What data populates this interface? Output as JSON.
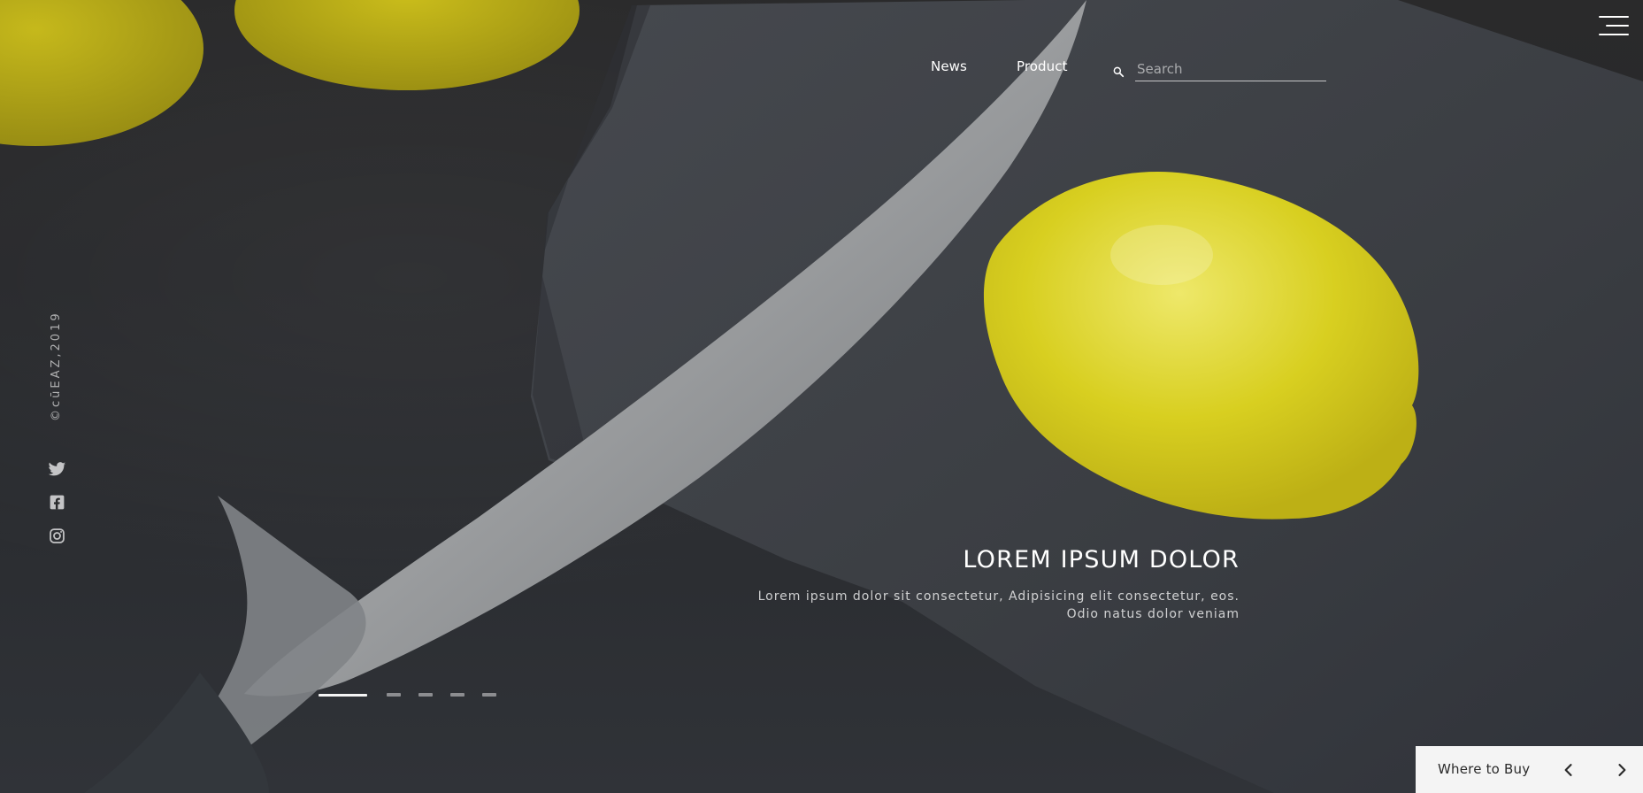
{
  "header": {
    "nav_items": [
      {
        "label": "News"
      },
      {
        "label": "Product"
      }
    ],
    "search": {
      "placeholder": "Search"
    },
    "menu_icon": "hamburger-menu-icon"
  },
  "sidebar": {
    "copyright": "©cūEAZ,2019",
    "social": [
      {
        "icon": "twitter-icon"
      },
      {
        "icon": "facebook-icon"
      },
      {
        "icon": "instagram-icon"
      }
    ]
  },
  "hero": {
    "headline": "LOREM IPSUM DOLOR",
    "description_lines": [
      "Lorem ipsum dolor sit consectetur, Adipisicing elit consectetur, eos.",
      "Odio natus dolor veniam"
    ],
    "slides": [
      {
        "active": true
      },
      {
        "active": false
      },
      {
        "active": false
      },
      {
        "active": false
      },
      {
        "active": false
      }
    ]
  },
  "footer_panel": {
    "label": "Where to Buy",
    "prev_icon": "chevron-left-icon",
    "next_icon": "chevron-right-icon"
  },
  "colors": {
    "background": "#2a2a2b",
    "lemon": "#d8cd1f",
    "knife": "#a7a8a9",
    "panel": "#f4f4f4",
    "text": "#ffffff"
  }
}
